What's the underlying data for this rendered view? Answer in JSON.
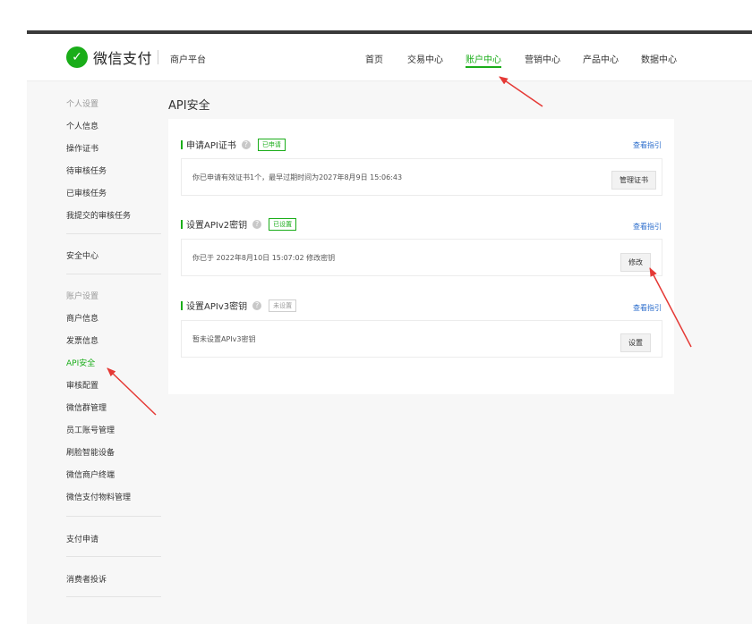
{
  "header": {
    "brand": "微信支付",
    "sub": "商户平台",
    "nav": [
      "首页",
      "交易中心",
      "账户中心",
      "营销中心",
      "产品中心",
      "数据中心"
    ],
    "active_nav": "账户中心"
  },
  "sidebar": {
    "group1": "个人设置",
    "items1": [
      "个人信息",
      "操作证书",
      "待审核任务",
      "已审核任务",
      "我提交的审核任务"
    ],
    "security": "安全中心",
    "group2": "账户设置",
    "items2": [
      "商户信息",
      "发票信息",
      "API安全",
      "审核配置",
      "微信群管理",
      "员工账号管理",
      "刷脸智能设备",
      "微信商户终端",
      "微信支付物料管理"
    ],
    "active_item": "API安全",
    "apply": "支付申请",
    "complaint": "消费者投诉"
  },
  "main": {
    "title": "API安全",
    "sections": [
      {
        "title": "申请API证书",
        "badge": "已申请",
        "guide": "查看指引",
        "text": "你已申请有效证书1个，最早过期时间为2027年8月9日 15:06:43",
        "button": "管理证书"
      },
      {
        "title": "设置APIv2密钥",
        "badge": "已设置",
        "guide": "查看指引",
        "text": "你已于 2022年8月10日 15:07:02 修改密钥",
        "button": "修改"
      },
      {
        "title": "设置APIv3密钥",
        "badge": "未设置",
        "guide": "查看指引",
        "text": "暂未设置APIv3密钥",
        "button": "设置"
      }
    ]
  },
  "colors": {
    "accent": "#1aad19",
    "link": "#2b6dcc",
    "arrow": "#e53935"
  }
}
